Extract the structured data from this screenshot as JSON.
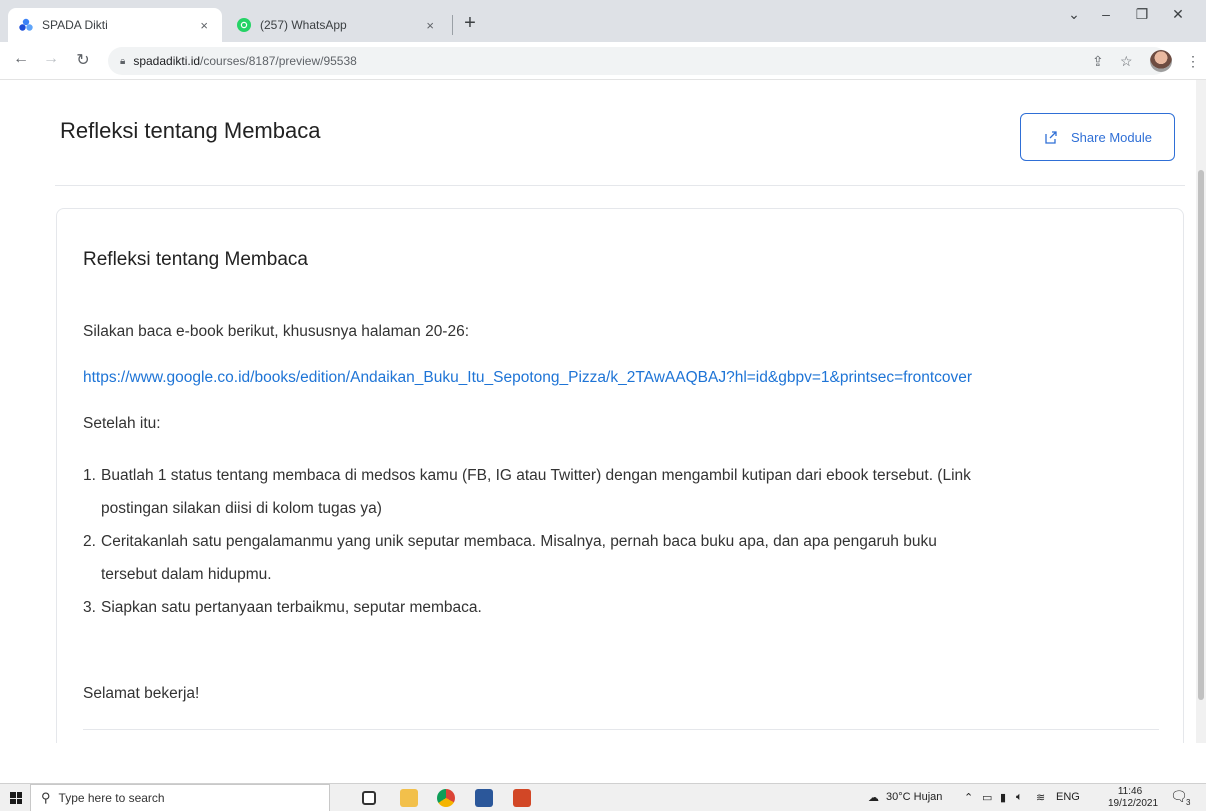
{
  "browser": {
    "tabs": [
      {
        "title": "SPADA Dikti",
        "active": true,
        "favicon": "spada-logo-icon"
      },
      {
        "title": "(257) WhatsApp",
        "active": false,
        "favicon": "whatsapp-icon"
      }
    ],
    "new_tab": "+",
    "close_glyph": "×",
    "url_host": "spadadikti.id",
    "url_path": "/courses/8187/preview/95538",
    "window_controls": {
      "dropdown": "⌄",
      "minimize": "–",
      "maximize": "❐",
      "close": "✕"
    }
  },
  "page": {
    "title": "Refleksi tentang Membaca",
    "share_label": "Share Module",
    "card": {
      "title": "Refleksi tentang Membaca",
      "intro": "Silakan baca e-book berikut, khususnya halaman 20-26:",
      "link": "https://www.google.co.id/books/edition/Andaikan_Buku_Itu_Sepotong_Pizza/k_2TAwAAQBAJ?hl=id&gbpv=1&printsec=frontcover",
      "after": "Setelah itu:",
      "steps": [
        {
          "num": "1.",
          "lines": [
            "Buatlah 1 status tentang membaca di medsos kamu (FB, IG atau Twitter) dengan mengambil kutipan dari ebook tersebut. (Link",
            "postingan silakan diisi di kolom tugas ya)"
          ]
        },
        {
          "num": "2.",
          "lines": [
            "Ceritakanlah satu pengalamanmu yang unik seputar membaca. Misalnya, pernah baca buku apa, dan apa pengaruh buku",
            "tersebut dalam hidupmu."
          ]
        },
        {
          "num": "3.",
          "lines": [
            "Siapkan satu pertanyaan terbaikmu, seputar membaca."
          ]
        }
      ],
      "closing": "Selamat bekerja!"
    }
  },
  "taskbar": {
    "search_placeholder": "Type here to search",
    "weather": "30°C  Hujan",
    "language": "ENG",
    "time": "11:46",
    "date": "19/12/2021",
    "notification_count": "3"
  },
  "colors": {
    "accent": "#2f6fd6",
    "link": "#1e74d6",
    "tabstrip": "#dee1e6"
  }
}
